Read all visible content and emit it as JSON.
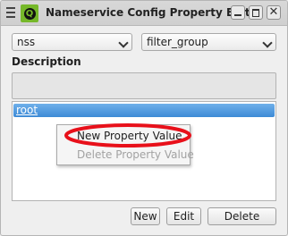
{
  "window": {
    "title": "Nameservice Config Property Editor",
    "logo_letter": "Q",
    "close_glyph": "✕"
  },
  "combos": {
    "left_value": "nss",
    "right_value": "filter_group"
  },
  "description": {
    "label": "Description",
    "value": ""
  },
  "tree": {
    "items": [
      {
        "label": "root",
        "selected": true
      }
    ]
  },
  "context_menu": {
    "items": [
      {
        "label": "New Property Value",
        "enabled": true
      },
      {
        "label": "Delete Property Value",
        "enabled": false
      }
    ]
  },
  "buttons": {
    "new_label": "New",
    "edit_label": "Edit",
    "delete_label": "Delete"
  },
  "colors": {
    "selection": "#3d8ad6",
    "highlight_ring": "#e8101a",
    "logo": "#76b82a"
  }
}
